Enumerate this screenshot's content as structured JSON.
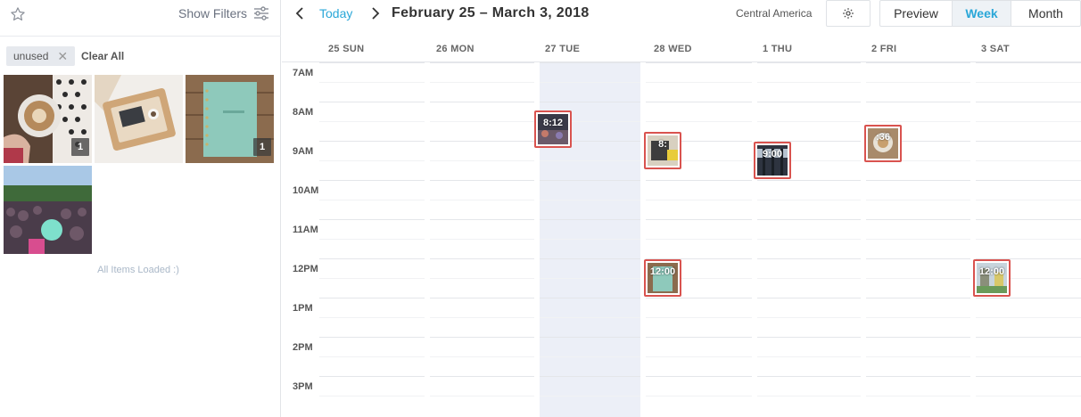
{
  "sidebar": {
    "show_filters_label": "Show Filters",
    "tags": [
      {
        "label": "unused"
      }
    ],
    "clear_all_label": "Clear All",
    "media": [
      {
        "icon": "coffee-photo",
        "count": "1"
      },
      {
        "icon": "laptop-tray-photo",
        "count": ""
      },
      {
        "icon": "notebook-photo",
        "count": "1"
      },
      {
        "icon": "crowd-photo",
        "count": ""
      }
    ],
    "status_text": "All Items Loaded :)"
  },
  "toolbar": {
    "today_label": "Today",
    "range_title": "February 25 – March 3, 2018",
    "timezone": "Central America",
    "views": {
      "preview": "Preview",
      "week": "Week",
      "month": "Month"
    },
    "active_view": "Week"
  },
  "calendar": {
    "days": [
      "25 SUN",
      "26 MON",
      "27 TUE",
      "28 WED",
      "1 THU",
      "2 FRI",
      "3 SAT"
    ],
    "highlight_day": "27 TUE",
    "hours": [
      "7AM",
      "8AM",
      "9AM",
      "10AM",
      "11AM",
      "12PM",
      "1PM",
      "2PM",
      "3PM"
    ],
    "events": [
      {
        "day": "27 TUE",
        "time": "8:12"
      },
      {
        "day": "28 WED",
        "time": "8:"
      },
      {
        "day": "1 THU",
        "time": "9:00"
      },
      {
        "day": "2 FRI",
        "time": ":36"
      },
      {
        "day": "28 WED",
        "time": "12:00"
      },
      {
        "day": "3 SAT",
        "time": "12:00"
      }
    ]
  },
  "colors": {
    "accent": "#2aa7d8",
    "event_border": "#d9534f",
    "highlight": "#eceff7"
  }
}
